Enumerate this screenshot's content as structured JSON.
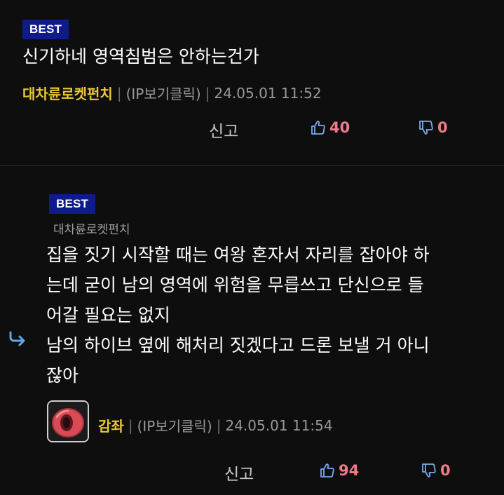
{
  "post": {
    "badge": "BEST",
    "title": "신기하네 영역침범은 안하는건가",
    "author": "대차륜로켓펀치",
    "ip_label": "(IP보기클릭)",
    "date": "24.05.01 11:52",
    "report_label": "신고",
    "likes": "40",
    "dislikes": "0"
  },
  "reply": {
    "badge": "BEST",
    "reply_to": "대차륜로켓펀치",
    "body": "집을 짓기 시작할 때는 여왕 혼자서 자리를 잡아야 하\n는데 굳이 남의 영역에 위험을 무릅쓰고 단신으로 들\n어갈 필요는 없지\n남의 하이브 옆에 해처리 짓겠다고 드론 보낼 거 아니\n잖아",
    "author": "감좌",
    "ip_label": "(IP보기클릭)",
    "date": "24.05.01 11:54",
    "report_label": "신고",
    "likes": "94",
    "dislikes": "0"
  },
  "icons": {
    "like": "thumbs-up-icon",
    "dislike": "thumbs-down-icon",
    "reply_arrow": "reply-arrow-icon"
  },
  "colors": {
    "badge_bg": "#0f1a8c",
    "nickname": "#e8c833",
    "count": "#f07a8a",
    "thumb_icon": "#7aa9f0"
  }
}
